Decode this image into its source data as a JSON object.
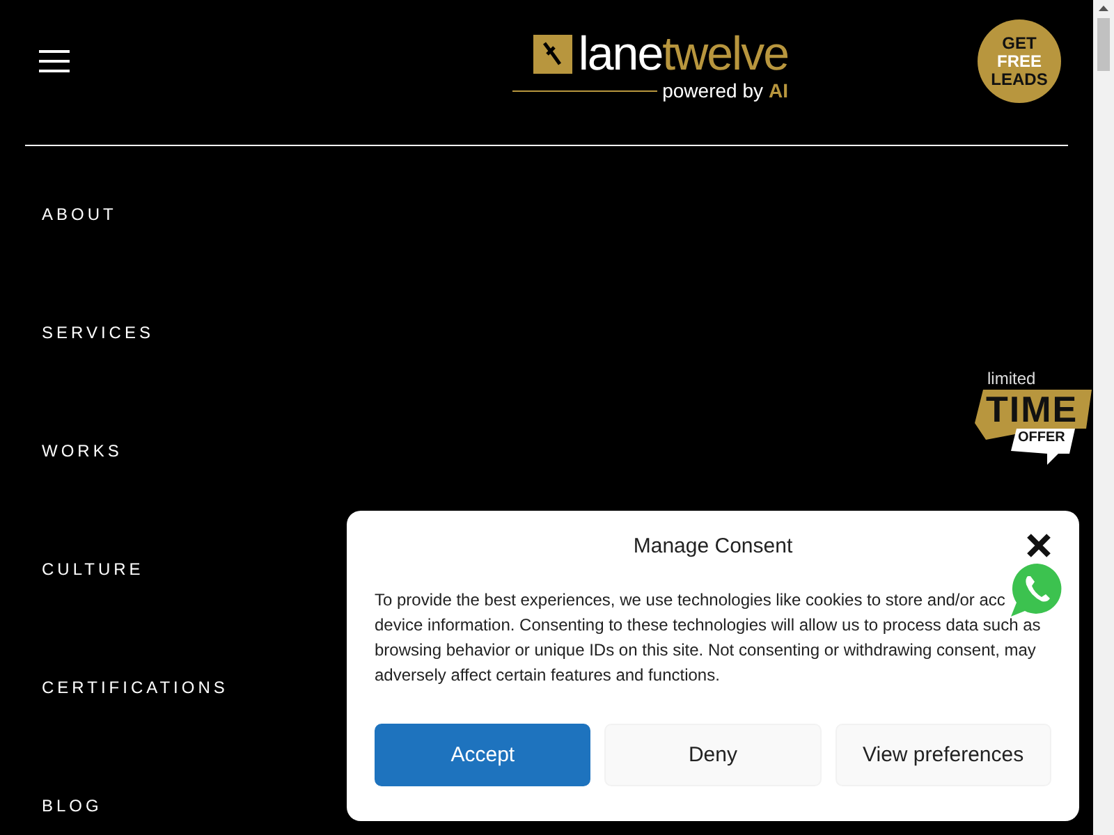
{
  "header": {
    "logo": {
      "word_1": "lane",
      "word_2": "twelve",
      "tagline": "powered by",
      "tagline_highlight": "AI"
    },
    "leads_badge": [
      "GET",
      "FREE",
      "LEADS"
    ]
  },
  "menu": [
    "ABOUT",
    "SERVICES",
    "WORKS",
    "CULTURE",
    "CERTIFICATIONS",
    "BLOG"
  ],
  "offer_badge": {
    "top": "limited",
    "main": "TIME",
    "bottom": "OFFER"
  },
  "consent": {
    "title": "Manage Consent",
    "text_first_line": "To provide the best experiences, we use technologies like cookies to store and/or acc",
    "text": "device information. Consenting to these technologies will allow us to process data such as browsing behavior or unique IDs on this site. Not consenting or withdrawing consent, may adversely affect certain features and functions.",
    "buttons": [
      {
        "label": "Accept",
        "kind": "primary"
      },
      {
        "label": "Deny",
        "kind": "secondary"
      },
      {
        "label": "View preferences",
        "kind": "secondary"
      }
    ]
  }
}
